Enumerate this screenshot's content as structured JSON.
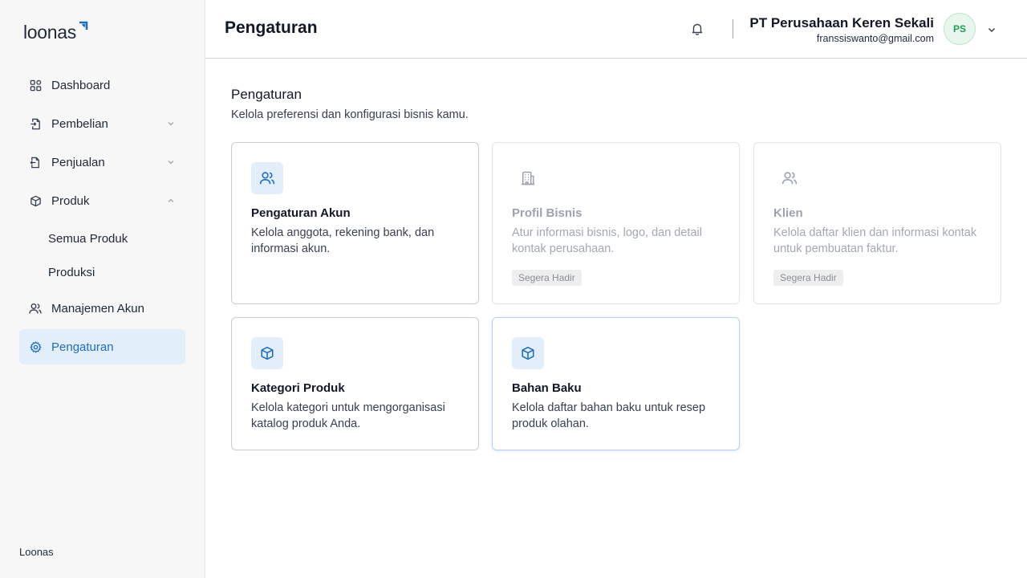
{
  "brand": {
    "name": "loonas",
    "accent": "#1a6fc4"
  },
  "sidebar": {
    "items": [
      {
        "label": "Dashboard",
        "icon": "grid-icon"
      },
      {
        "label": "Pembelian",
        "icon": "file-import-icon",
        "expandable": true,
        "expanded": false
      },
      {
        "label": "Penjualan",
        "icon": "file-export-icon",
        "expandable": true,
        "expanded": false
      },
      {
        "label": "Produk",
        "icon": "cube-icon",
        "expandable": true,
        "expanded": true,
        "children": [
          {
            "label": "Semua Produk"
          },
          {
            "label": "Produksi"
          }
        ]
      },
      {
        "label": "Manajemen Akun",
        "icon": "users-icon"
      },
      {
        "label": "Pengaturan",
        "icon": "gear-icon",
        "active": true
      }
    ],
    "footer": "Loonas"
  },
  "header": {
    "title": "Pengaturan",
    "company": "PT Perusahaan Keren Sekali",
    "email": "franssiswanto@gmail.com",
    "avatar_initials": "PS"
  },
  "main": {
    "heading": "Pengaturan",
    "subheading": "Kelola preferensi dan konfigurasi bisnis kamu.",
    "cards": [
      {
        "title": "Pengaturan Akun",
        "desc": "Kelola anggota, rekening bank, dan informasi akun.",
        "icon": "users-icon",
        "disabled": false
      },
      {
        "title": "Profil Bisnis",
        "desc": "Atur informasi bisnis, logo, dan detail kontak perusahaan.",
        "icon": "building-icon",
        "disabled": true,
        "badge": "Segera Hadir"
      },
      {
        "title": "Klien",
        "desc": "Kelola daftar klien dan informasi kontak untuk pembuatan faktur.",
        "icon": "users-icon",
        "disabled": true,
        "badge": "Segera Hadir"
      },
      {
        "title": "Kategori Produk",
        "desc": "Kelola kategori untuk mengorganisasi katalog produk Anda.",
        "icon": "cube-icon",
        "disabled": false
      },
      {
        "title": "Bahan Baku",
        "desc": "Kelola daftar bahan baku untuk resep produk olahan.",
        "icon": "cube-icon",
        "disabled": false
      }
    ]
  }
}
